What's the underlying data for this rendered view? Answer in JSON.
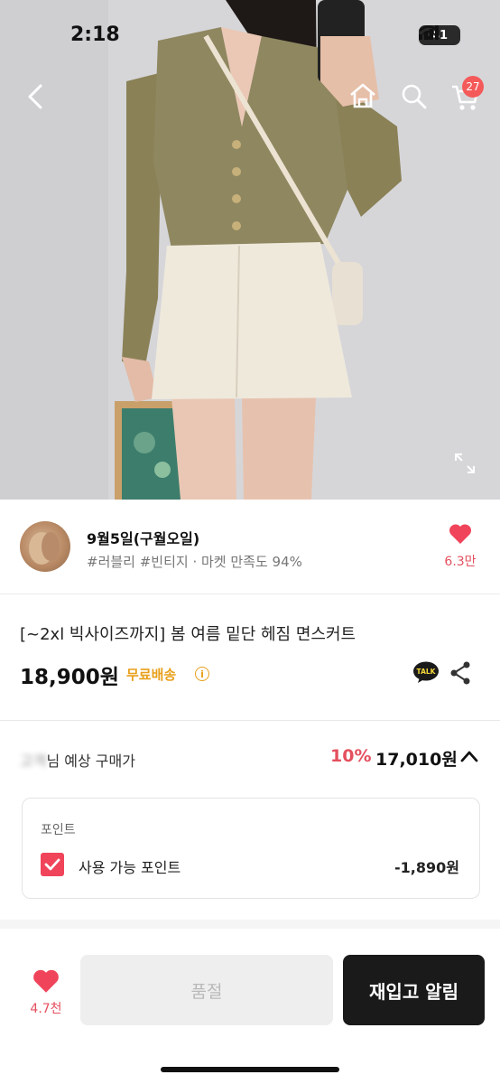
{
  "status_bar": {
    "time": "2:18",
    "battery": "41"
  },
  "header": {
    "cart_count": "27"
  },
  "seller": {
    "name": "9월5일(구월오일)",
    "tags": "#러블리 #빈티지 · 마켓 만족도 94%",
    "like_count": "6.3만"
  },
  "product": {
    "title": "[~2xl 빅사이즈까지] 봄 여름 밑단 헤짐 면스커트",
    "price": "18,900원",
    "shipping": "무료배송",
    "info_glyph": "i",
    "talk_label": "TALK"
  },
  "expected": {
    "blur_name": "님",
    "label": "예상 구매가",
    "discount": "10%",
    "price": "17,010원"
  },
  "points": {
    "label": "포인트",
    "use_label": "사용 가능 포인트",
    "value": "-1,890원"
  },
  "bottom_bar": {
    "like_count": "4.7천",
    "soldout_label": "품절",
    "restock_label": "재입고 알림"
  },
  "colors": {
    "accent_red": "#e4505e",
    "shipping_yellow": "#e8a01c",
    "dark_button": "#1a1a1a"
  },
  "icons": [
    "back-arrow-icon",
    "home-icon",
    "search-icon",
    "cart-icon",
    "expand-icon",
    "heart-icon",
    "info-icon",
    "kakao-talk-icon",
    "share-icon",
    "chevron-up-icon",
    "checkbox-checked-icon"
  ]
}
